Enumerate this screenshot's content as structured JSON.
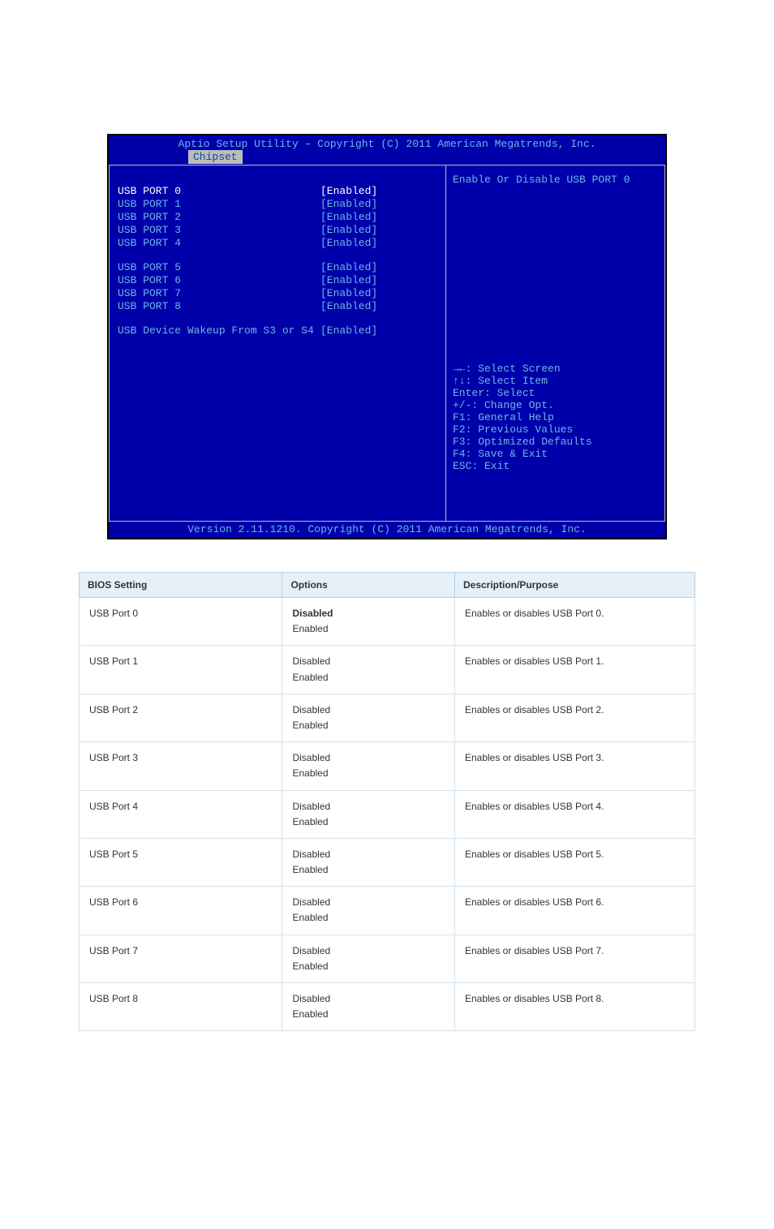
{
  "bios": {
    "title": "Aptio Setup Utility – Copyright (C) 2011 American Megatrends, Inc.",
    "tab": "Chipset",
    "group1": [
      {
        "label": "USB PORT 0",
        "value": "[Enabled]"
      },
      {
        "label": "USB PORT 1",
        "value": "[Enabled]"
      },
      {
        "label": "USB PORT 2",
        "value": "[Enabled]"
      },
      {
        "label": "USB PORT 3",
        "value": "[Enabled]"
      },
      {
        "label": "USB PORT 4",
        "value": "[Enabled]"
      }
    ],
    "group2": [
      {
        "label": "USB PORT 5",
        "value": "[Enabled]"
      },
      {
        "label": "USB PORT 6",
        "value": "[Enabled]"
      },
      {
        "label": "USB PORT 7",
        "value": "[Enabled]"
      },
      {
        "label": "USB PORT 8",
        "value": "[Enabled]"
      }
    ],
    "group3": [
      {
        "label": "USB Device Wakeup From S3 or S4",
        "value": "[Enabled]"
      }
    ],
    "help_top": "Enable Or Disable USB PORT 0",
    "nav": [
      "→←: Select Screen",
      "↑↓: Select Item",
      "Enter: Select",
      "+/-: Change Opt.",
      "F1: General Help",
      "F2: Previous Values",
      "F3: Optimized Defaults",
      "F4: Save & Exit",
      "ESC: Exit"
    ],
    "footer": "Version 2.11.1210. Copyright (C) 2011 American Megatrends, Inc."
  },
  "table": {
    "headers": [
      "BIOS Setting",
      "Options",
      "Description/Purpose"
    ],
    "rows": [
      {
        "setting": "USB Port 0",
        "options": "DisabledEnabled",
        "options_prefix": "Disabled",
        "options_rest": "\nEnabled",
        "desc": "Enables or disables USB Port 0."
      },
      {
        "setting": "USB Port 1",
        "options": "Disabled\nEnabled",
        "desc": "Enables or disables USB Port 1."
      },
      {
        "setting": "USB Port 2",
        "options": "Disabled\nEnabled",
        "desc": "Enables or disables USB Port 2."
      },
      {
        "setting": "USB Port 3",
        "options": "Disabled\nEnabled",
        "desc": "Enables or disables USB Port 3."
      },
      {
        "setting": "USB Port 4",
        "options": "Disabled\nEnabled",
        "desc": "Enables or disables USB Port 4."
      },
      {
        "setting": "USB Port 5",
        "options": "Disabled\nEnabled",
        "desc": "Enables or disables USB Port 5."
      },
      {
        "setting": "USB Port 6",
        "options": "Disabled\nEnabled",
        "desc": "Enables or disables USB Port 6."
      },
      {
        "setting": "USB Port 7",
        "options": "Disabled\nEnabled",
        "desc": "Enables or disables USB Port 7."
      },
      {
        "setting": "USB Port 8",
        "options": "Disabled\nEnabled",
        "desc": "Enables or disables USB Port 8."
      }
    ]
  }
}
